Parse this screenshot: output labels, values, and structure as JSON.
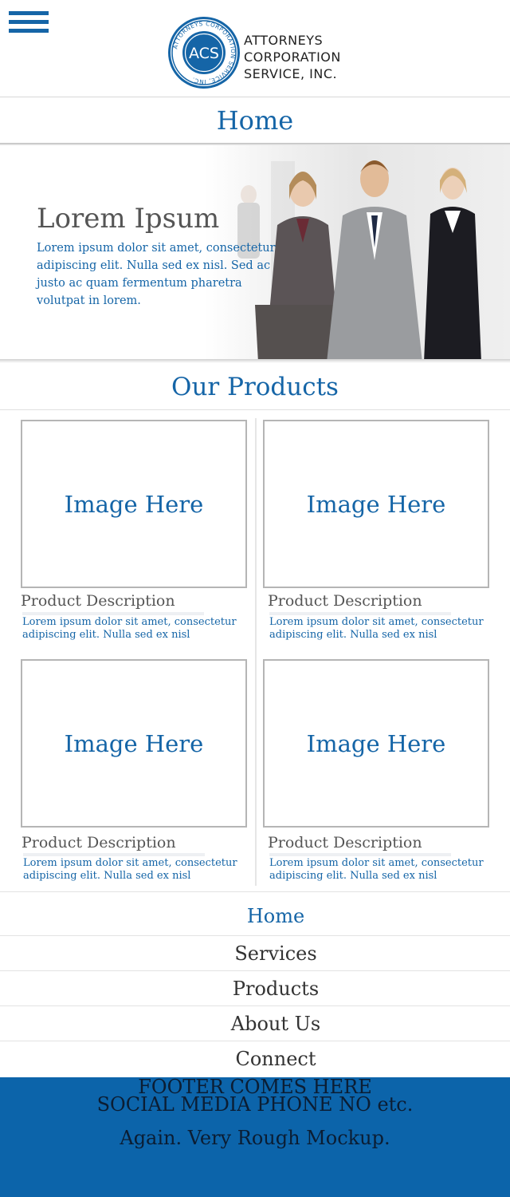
{
  "header": {
    "menu_icon": "hamburger-menu-icon",
    "logo": {
      "seal_text": "ACS",
      "seal_ring_text": "ATTORNEYS CORPORATION SERVICE, INC.",
      "line1": "ATTORNEYS",
      "line2": "CORPORATION",
      "line3": "SERVICE, INC."
    },
    "page_title": "Home"
  },
  "hero": {
    "title": "Lorem Ipsum",
    "text": "Lorem ipsum dolor sit amet, consectetur adipiscing elit. Nulla sed ex nisl. Sed ac justo ac quam fermentum pharetra volutpat in lorem."
  },
  "products": {
    "title": "Our Products",
    "items": [
      {
        "image_label": "Image Here",
        "title": "Product Description",
        "desc": "Lorem ipsum dolor sit amet, consectetur adipiscing elit. Nulla sed ex nisl"
      },
      {
        "image_label": "Image Here",
        "title": "Product Description",
        "desc": "Lorem ipsum dolor sit amet, consectetur adipiscing elit. Nulla sed ex nisl"
      },
      {
        "image_label": "Image Here",
        "title": "Product Description",
        "desc": "Lorem ipsum dolor sit amet, consectetur adipiscing elit. Nulla sed ex nisl"
      },
      {
        "image_label": "Image Here",
        "title": "Product Description",
        "desc": "Lorem ipsum dolor sit amet, consectetur adipiscing elit. Nulla sed ex nisl"
      }
    ]
  },
  "nav": {
    "items": [
      {
        "label": "Home"
      },
      {
        "label": "Services"
      },
      {
        "label": "Products"
      },
      {
        "label": "About Us"
      },
      {
        "label": "Connect"
      }
    ]
  },
  "footer": {
    "line1": "FOOTER COMES HERE",
    "line2": "SOCIAL MEDIA PHONE NO etc.",
    "line3": "Again. Very Rough Mockup."
  },
  "colors": {
    "brand_blue": "#1565a7",
    "footer_blue": "#0c64aa"
  }
}
